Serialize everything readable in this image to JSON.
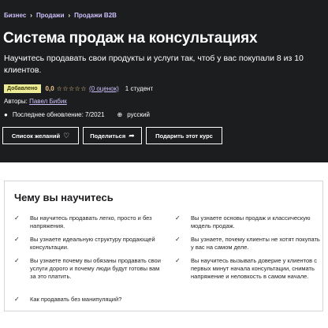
{
  "breadcrumb": {
    "items": [
      "Бизнес",
      "Продажи",
      "Продажи B2B"
    ],
    "separator": "›"
  },
  "course": {
    "title": "Система продаж на консультациях",
    "subtitle": "Научитесь продавать свои продукты и услуги так, чтоб у вас покупали 8 из 10 клиентов.",
    "badge": "Добавлено",
    "rating_value": "0,0",
    "stars": "☆☆☆☆☆",
    "ratings_link": "(0 оценок)",
    "students": "1 студент",
    "authors_label": "Авторы:",
    "author_name": "Павел Бибик",
    "updated_icon": "●",
    "updated": "Последнее обновление: 7/2021",
    "language_icon": "⊕",
    "language": "русский"
  },
  "actions": {
    "wishlist_label": "Список желаний",
    "wishlist_icon": "♡",
    "share_label": "Поделиться",
    "share_icon": "➦",
    "gift_label": "Подарить этот курс"
  },
  "learn": {
    "title": "Чему вы научитесь",
    "check_icon": "✓",
    "items": [
      "Вы научитесь продавать легко, просто и без напряжения.",
      "Вы узнаете основы продаж и классическую модель продаж.",
      "Вы узнаете идеальную структуру продающей консультации.",
      "Вы узнаете, почему клиенты не хотят покупать у вас на самом деле.",
      "Вы узнаете почему вы обязаны продавать свои услуги дорого и почему люди будут готовы вам за это платить.",
      "Вы научитесь вызывать доверие у клиентов с первых минут начала консультации, снимать напряжение и неловкость в самом начале.",
      "Как продавать без манипуляций?"
    ]
  },
  "colors": {
    "hero_bg": "#1c1d1f",
    "link": "#cec0fc",
    "rating": "#f3ca8c",
    "badge_bg": "#eceb98"
  }
}
